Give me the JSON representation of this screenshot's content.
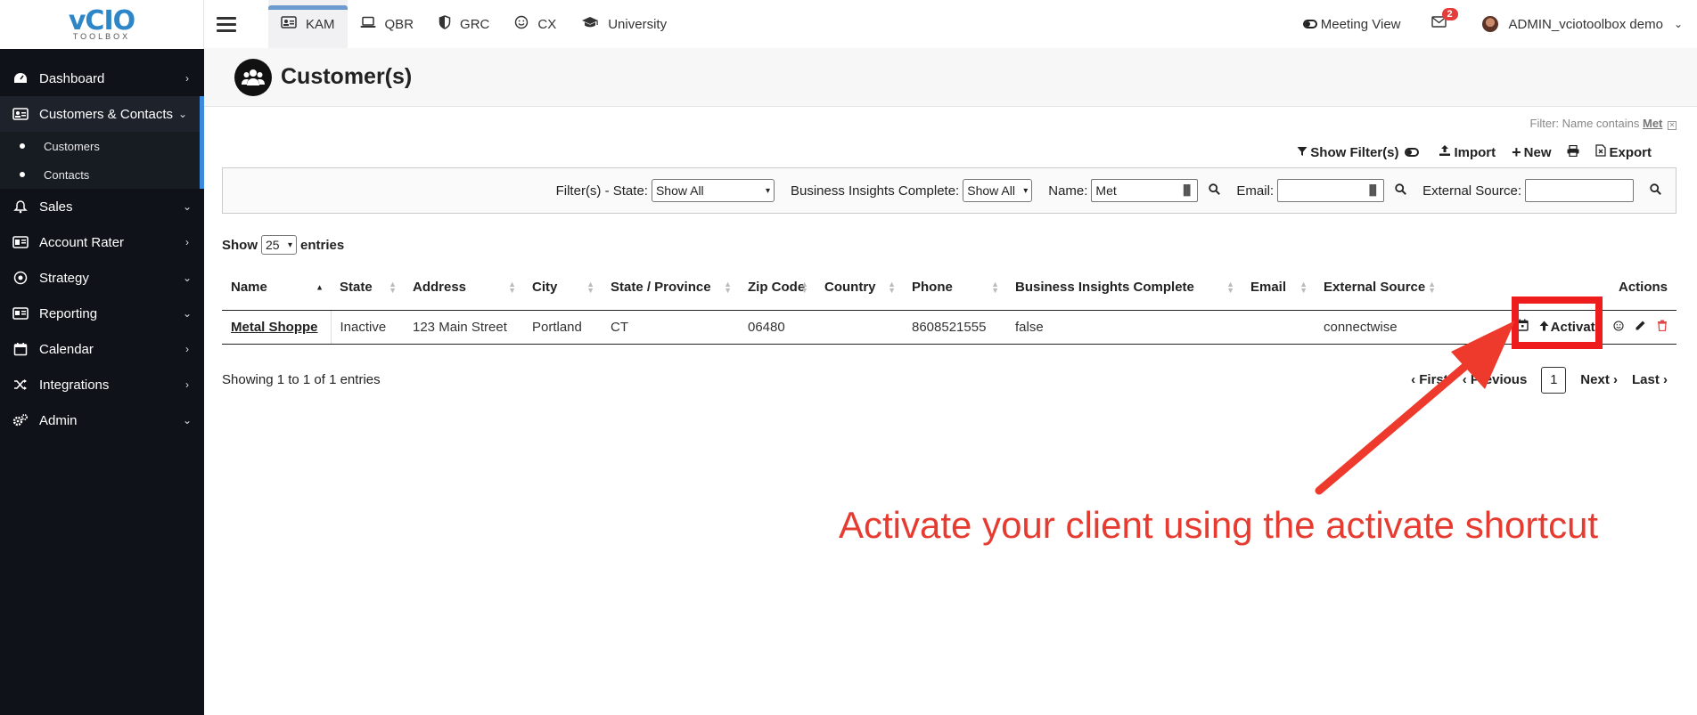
{
  "logo": {
    "brand": "vCIO",
    "sub": "TOOLBOX"
  },
  "sidebar": {
    "items": [
      {
        "label": "Dashboard",
        "icon": "dashboard-icon"
      },
      {
        "label": "Customers & Contacts",
        "icon": "address-card-icon"
      },
      {
        "label": "Sales",
        "icon": "bell-icon"
      },
      {
        "label": "Account Rater",
        "icon": "id-card-icon"
      },
      {
        "label": "Strategy",
        "icon": "target-icon"
      },
      {
        "label": "Reporting",
        "icon": "report-icon"
      },
      {
        "label": "Calendar",
        "icon": "calendar-icon"
      },
      {
        "label": "Integrations",
        "icon": "shuffle-icon"
      },
      {
        "label": "Admin",
        "icon": "cogs-icon"
      }
    ],
    "subitems": [
      "Customers",
      "Contacts"
    ]
  },
  "topbar": {
    "tabs": [
      "KAM",
      "QBR",
      "GRC",
      "CX",
      "University"
    ],
    "meeting_view": "Meeting View",
    "mail_count": "2",
    "user": "ADMIN_vciotoolbox demo"
  },
  "page": {
    "title": "Customer(s)"
  },
  "filter_note": {
    "prefix": "Filter: Name contains",
    "value": "Met"
  },
  "actions": {
    "show_filters": "Show Filter(s)",
    "import": "Import",
    "new": "New",
    "export": "Export"
  },
  "filters": {
    "state_label": "Filter(s) - State:",
    "state_value": "Show All",
    "bi_label": "Business Insights Complete:",
    "bi_value": "Show All",
    "name_label": "Name:",
    "name_value": "Met",
    "email_label": "Email:",
    "email_value": "",
    "source_label": "External Source:",
    "source_value": ""
  },
  "entries": {
    "show": "Show",
    "count": "25",
    "suffix": "entries"
  },
  "table": {
    "headers": [
      "Name",
      "State",
      "Address",
      "City",
      "State / Province",
      "Zip Code",
      "Country",
      "Phone",
      "Business Insights Complete",
      "Email",
      "External Source",
      "",
      "Actions"
    ],
    "rows": [
      {
        "name": "Metal Shoppe",
        "state": "Inactive",
        "address": "123 Main Street",
        "city": "Portland",
        "province": "CT",
        "zip": "06480",
        "country": "",
        "phone": "8608521555",
        "bi": "false",
        "email": "",
        "source": "connectwise",
        "activate": "Activate"
      }
    ]
  },
  "footer": {
    "showing": "Showing 1 to 1 of 1 entries",
    "first": "First",
    "previous": "Previous",
    "page": "1",
    "next": "Next",
    "last": "Last"
  },
  "annotation": {
    "text": "Activate your client using the activate shortcut",
    "color": "#e63b30"
  }
}
